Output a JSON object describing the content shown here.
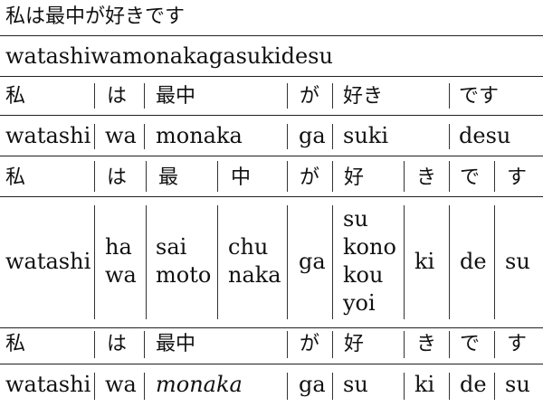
{
  "sentence": {
    "japanese": "私は最中が好きです",
    "romaji": "watashiwamonakagasukidesu"
  },
  "table1": {
    "kanji": [
      "私",
      "は",
      "最中",
      "が",
      "好き",
      "です"
    ],
    "romaji": [
      "watashi",
      "wa",
      "monaka",
      "ga",
      "suki",
      "desu"
    ]
  },
  "table2": {
    "kanji": [
      "私",
      "は",
      "最",
      "中",
      "が",
      "好",
      "き",
      "で",
      "す"
    ],
    "readings": [
      [
        "watashi"
      ],
      [
        "ha",
        "wa"
      ],
      [
        "sai",
        "moto"
      ],
      [
        "chu",
        "naka"
      ],
      [
        "ga"
      ],
      [
        "su",
        "kono",
        "kou",
        "yoi"
      ],
      [
        "ki"
      ],
      [
        "de"
      ],
      [
        "su"
      ]
    ]
  },
  "table3": {
    "kanji": [
      "私",
      "は",
      "最中",
      "が",
      "好",
      "き",
      "で",
      "す"
    ],
    "romaji": [
      "watashi",
      "wa",
      "monaka",
      "ga",
      "su",
      "ki",
      "de",
      "su"
    ]
  }
}
